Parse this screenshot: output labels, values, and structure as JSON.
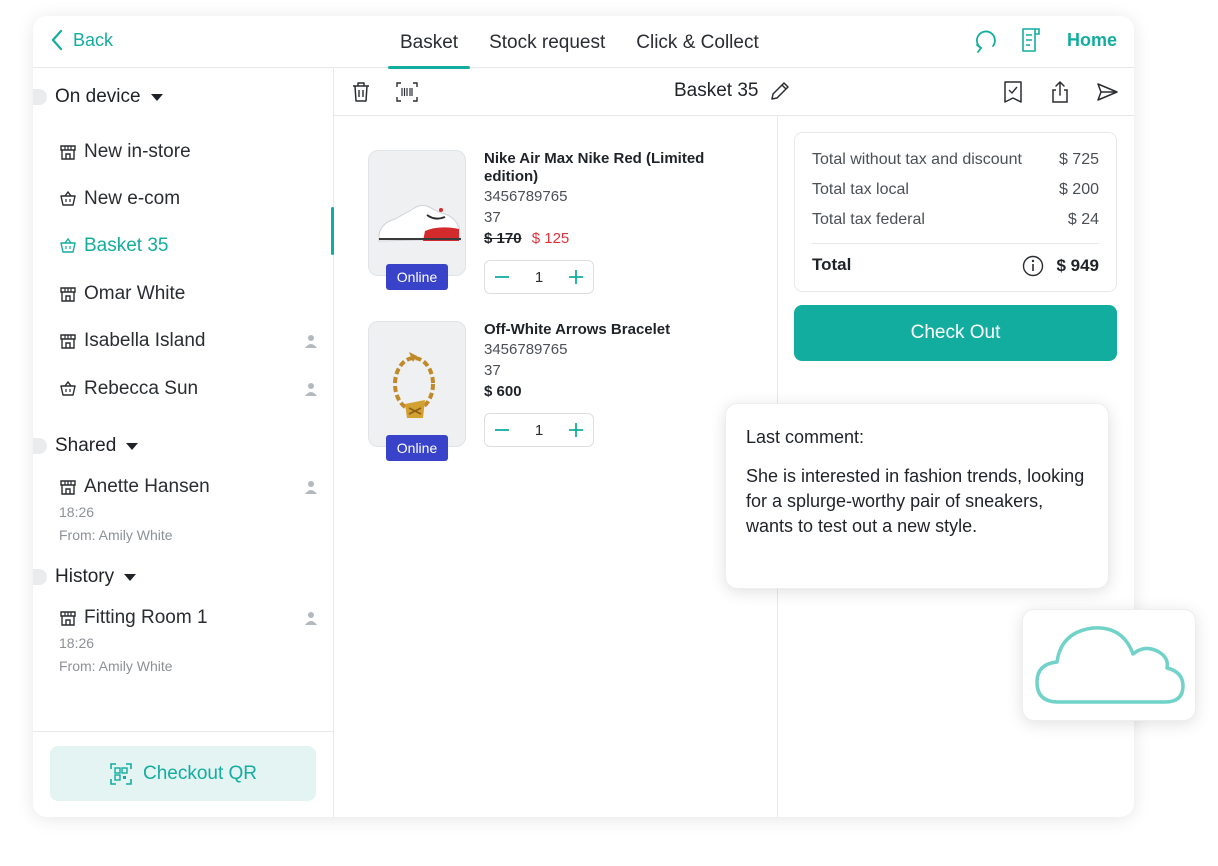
{
  "header": {
    "back_label": "Back",
    "tabs": [
      {
        "label": "Basket",
        "active": true
      },
      {
        "label": "Stock request",
        "active": false
      },
      {
        "label": "Click & Collect",
        "active": false
      }
    ],
    "home_label": "Home",
    "icons": [
      "refresh-icon",
      "receipt-icon"
    ]
  },
  "sidebar": {
    "sections": [
      {
        "label": "On device"
      },
      {
        "label": "Shared"
      },
      {
        "label": "History"
      }
    ],
    "items": [
      {
        "label": "New in-store",
        "icon": "store-icon"
      },
      {
        "label": "New e-com",
        "icon": "basket-icon"
      },
      {
        "label": "Basket 35",
        "icon": "basket-icon",
        "active": true
      },
      {
        "label": "Omar White",
        "icon": "store-icon"
      },
      {
        "label": "Isabella Island",
        "icon": "store-icon",
        "person": true
      },
      {
        "label": "Rebecca Sun",
        "icon": "basket-icon",
        "person": true
      },
      {
        "label": "Anette Hansen",
        "icon": "store-icon",
        "person": true,
        "time": "18:26",
        "from": "From: Amily White"
      },
      {
        "label": "Fitting Room 1",
        "icon": "store-icon",
        "person": true,
        "time": "18:26",
        "from": "From: Amily White"
      }
    ],
    "checkout_qr_label": "Checkout QR"
  },
  "toolbar": {
    "title": "Basket 35"
  },
  "products": [
    {
      "name": "Nike Air Max Nike Red (Limited edition)",
      "sku": "3456789765",
      "size": "37",
      "old_price": "$ 170",
      "price": "$ 125",
      "badge": "Online",
      "qty": "1"
    },
    {
      "name": "Off-White Arrows Bracelet",
      "sku": "3456789765",
      "size": "37",
      "price": "$ 600",
      "badge": "Online",
      "qty": "1"
    }
  ],
  "summary": {
    "rows": [
      {
        "label": "Total without tax and discount",
        "value": "$ 725"
      },
      {
        "label": "Total tax local",
        "value": "$ 200"
      },
      {
        "label": "Total tax federal",
        "value": "$ 24"
      }
    ],
    "total_label": "Total",
    "total_value": "$ 949",
    "checkout_label": "Check Out"
  },
  "comment": {
    "title": "Last comment:",
    "body": "She is interested in fashion trends, looking for a splurge-worthy pair of sneakers, wants to test out a new style."
  },
  "colors": {
    "accent": "#13ada0",
    "badge": "#3843c9",
    "sale": "#e0323a"
  }
}
